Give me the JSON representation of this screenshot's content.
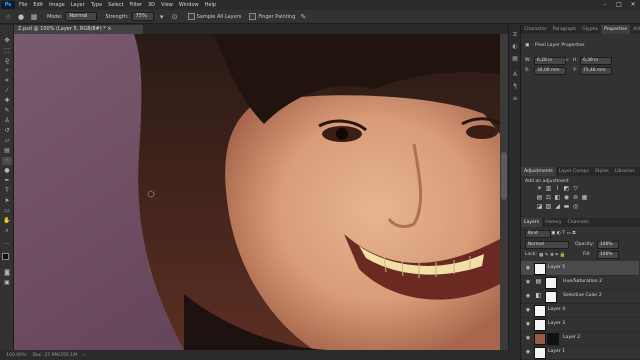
{
  "menu": {
    "logo": "Ps",
    "items": [
      "File",
      "Edit",
      "Image",
      "Layer",
      "Type",
      "Select",
      "Filter",
      "3D",
      "View",
      "Window",
      "Help"
    ],
    "window_controls": [
      "–",
      "□",
      "✕"
    ]
  },
  "options": {
    "mode_label": "Mode:",
    "mode_value": "Normal",
    "strength_label": "Strength:",
    "strength_value": "75%",
    "sample_all_layers": "Sample All Layers",
    "finger_painting": "Finger Painting"
  },
  "document": {
    "tab_title": "Z.psd @ 100% (Layer 5, RGB/8#) *"
  },
  "status": {
    "zoom": "100.00%",
    "doc": "Doc: 27.9M/250.1M"
  },
  "panels": {
    "top_tabs": [
      "Character",
      "Paragraph",
      "Glyphs",
      "Properties",
      "Actions"
    ],
    "properties": {
      "title": "Pixel Layer Properties",
      "w_label": "W:",
      "w_value": "6,28 in",
      "h_label": "H:",
      "h_value": "6,39 in",
      "x_label": "X:",
      "x_value": "30,00 mm",
      "y_label": "Y:",
      "y_value": "75,46 mm"
    },
    "mid_tabs": [
      "Adjustments",
      "Layer Comps",
      "Styles",
      "Libraries"
    ],
    "adjustments_title": "Add an adjustment",
    "layers_tabs": [
      "Layers",
      "History",
      "Channels"
    ],
    "layers_filter": "Kind",
    "blend_mode": "Normal",
    "opacity_label": "Opacity:",
    "opacity_value": "100%",
    "lock_label": "Lock:",
    "fill_label": "Fill:",
    "fill_value": "100%",
    "layers": [
      {
        "name": "Layer 5"
      },
      {
        "name": "Hue/Saturation 2"
      },
      {
        "name": "Selective Color 2"
      },
      {
        "name": "Layer 4"
      },
      {
        "name": "Layer 3"
      },
      {
        "name": "Layer 2"
      },
      {
        "name": "Layer 1"
      }
    ]
  },
  "colors": {
    "accent": "#31a8ff",
    "panel": "#323232",
    "background_purple": "#6e4d63"
  }
}
